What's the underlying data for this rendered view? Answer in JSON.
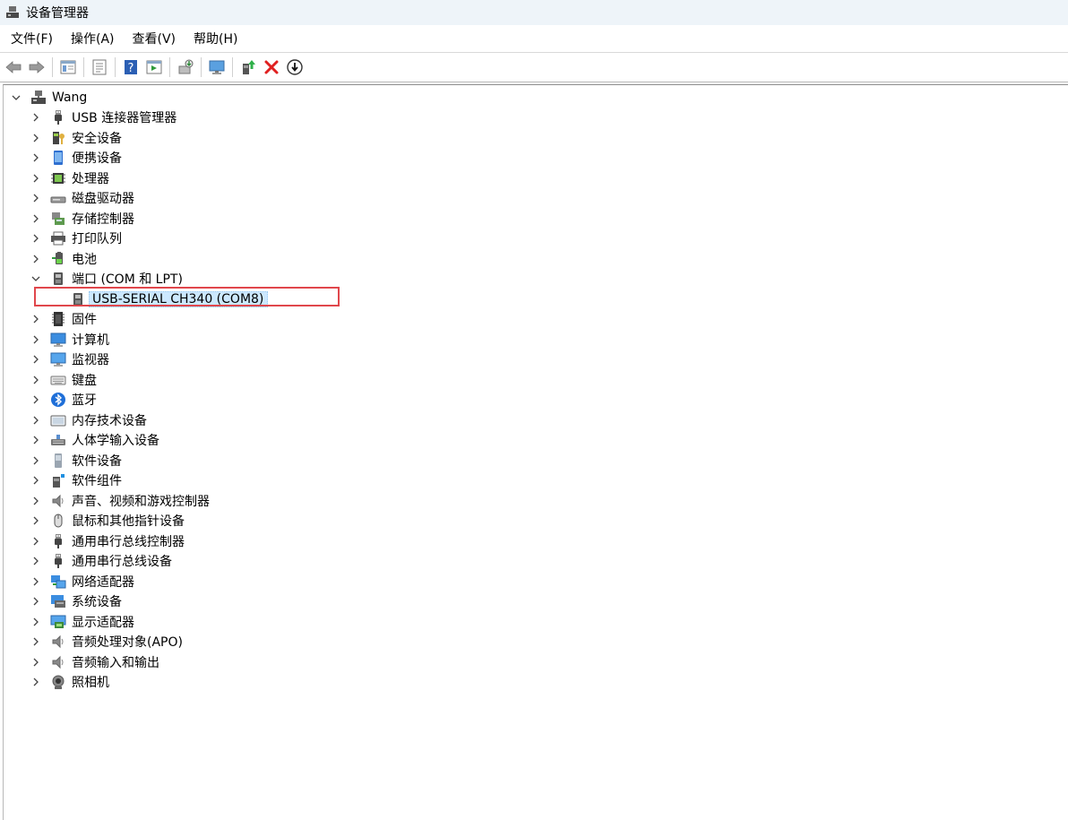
{
  "window": {
    "title": "设备管理器"
  },
  "menu": [
    {
      "label": "文件(F)"
    },
    {
      "label": "操作(A)"
    },
    {
      "label": "查看(V)"
    },
    {
      "label": "帮助(H)"
    }
  ],
  "toolbar": [
    {
      "icon": "back-arrow-icon"
    },
    {
      "icon": "forward-arrow-icon"
    },
    {
      "icon": "console-tree-icon"
    },
    {
      "icon": "properties-icon"
    },
    {
      "icon": "help-icon"
    },
    {
      "icon": "run-action-icon"
    },
    {
      "icon": "scan-hardware-icon"
    },
    {
      "icon": "monitor-icon"
    },
    {
      "icon": "update-driver-icon"
    },
    {
      "icon": "uninstall-x-icon"
    },
    {
      "icon": "disable-device-icon"
    }
  ],
  "tree": {
    "root": "Wang",
    "items": [
      {
        "label": "USB 连接器管理器",
        "icon": "usb-plug-icon"
      },
      {
        "label": "安全设备",
        "icon": "security-key-icon"
      },
      {
        "label": "便携设备",
        "icon": "portable-device-icon"
      },
      {
        "label": "处理器",
        "icon": "processor-chip-icon"
      },
      {
        "label": "磁盘驱动器",
        "icon": "disk-drive-icon"
      },
      {
        "label": "存储控制器",
        "icon": "storage-controller-icon"
      },
      {
        "label": "打印队列",
        "icon": "printer-icon"
      },
      {
        "label": "电池",
        "icon": "battery-icon"
      },
      {
        "label": "端口 (COM 和 LPT)",
        "icon": "port-connector-icon",
        "expanded": true,
        "children": [
          {
            "label": "USB-SERIAL CH340 (COM8)",
            "icon": "port-connector-icon"
          }
        ]
      },
      {
        "label": "固件",
        "icon": "firmware-chip-icon"
      },
      {
        "label": "计算机",
        "icon": "computer-icon"
      },
      {
        "label": "监视器",
        "icon": "monitor-icon"
      },
      {
        "label": "键盘",
        "icon": "keyboard-icon"
      },
      {
        "label": "蓝牙",
        "icon": "bluetooth-icon"
      },
      {
        "label": "内存技术设备",
        "icon": "memory-card-icon"
      },
      {
        "label": "人体学输入设备",
        "icon": "hid-icon"
      },
      {
        "label": "软件设备",
        "icon": "software-device-icon"
      },
      {
        "label": "软件组件",
        "icon": "software-component-icon"
      },
      {
        "label": "声音、视频和游戏控制器",
        "icon": "speaker-icon"
      },
      {
        "label": "鼠标和其他指针设备",
        "icon": "mouse-icon"
      },
      {
        "label": "通用串行总线控制器",
        "icon": "usb-plug-icon"
      },
      {
        "label": "通用串行总线设备",
        "icon": "usb-plug-icon"
      },
      {
        "label": "网络适配器",
        "icon": "network-adapter-icon"
      },
      {
        "label": "系统设备",
        "icon": "system-device-icon"
      },
      {
        "label": "显示适配器",
        "icon": "display-adapter-icon"
      },
      {
        "label": "音频处理对象(APO)",
        "icon": "speaker-icon"
      },
      {
        "label": "音频输入和输出",
        "icon": "speaker-icon"
      },
      {
        "label": "照相机",
        "icon": "camera-icon"
      }
    ]
  },
  "colors": {
    "selection": "#cce8ff",
    "highlight_border": "#e0474c",
    "titlebar": "#eef4f9"
  }
}
